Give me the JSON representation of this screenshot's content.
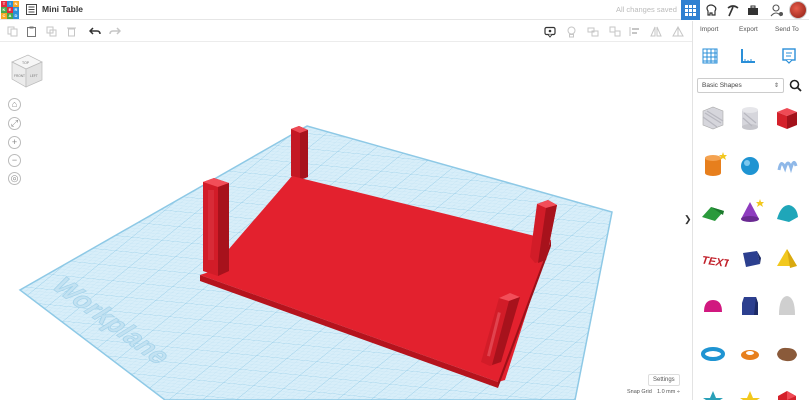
{
  "app": {
    "logo_letters": [
      "T",
      "I",
      "N",
      "K",
      "E",
      "R",
      "C",
      "A",
      "D"
    ],
    "logo_colors": [
      "#e4293c",
      "#2a8fd8",
      "#f5a623",
      "#4aa84a",
      "#e4293c",
      "#2a8fd8",
      "#f5a623",
      "#4aa84a",
      "#2a8fd8"
    ],
    "title": "Mini Table",
    "save_status": "All changes saved"
  },
  "panel": {
    "tabs": [
      "Import",
      "Export",
      "Send To"
    ],
    "shape_category": "Basic Shapes",
    "collapse_glyph": "❯",
    "shapes": [
      {
        "name": "box-hole",
        "color": "#c9c9cf"
      },
      {
        "name": "cylinder-hole",
        "color": "#c9c9cf"
      },
      {
        "name": "box",
        "color": "#d4212b"
      },
      {
        "name": "cylinder",
        "color": "#e77f1d"
      },
      {
        "name": "sphere",
        "color": "#1f94d2"
      },
      {
        "name": "scribble",
        "color": "#8fb8e8"
      },
      {
        "name": "roof",
        "color": "#2a9a3c"
      },
      {
        "name": "cone",
        "color": "#8e3cbf"
      },
      {
        "name": "round-roof",
        "color": "#1fa6b9"
      },
      {
        "name": "text",
        "color": "#c1202a"
      },
      {
        "name": "diamond",
        "color": "#2c3f8f"
      },
      {
        "name": "pyramid",
        "color": "#f2c81e"
      },
      {
        "name": "half-sphere",
        "color": "#d1187f"
      },
      {
        "name": "polygon",
        "color": "#2c3f8f"
      },
      {
        "name": "paraboloid",
        "color": "#cfcfcf"
      },
      {
        "name": "torus",
        "color": "#1f94d2"
      },
      {
        "name": "tube",
        "color": "#e77f1d"
      },
      {
        "name": "shape-generator",
        "color": "#8a5a3a"
      },
      {
        "name": "star",
        "color": "#2aa0b8"
      },
      {
        "name": "star-gold",
        "color": "#f2c81e"
      },
      {
        "name": "icosahedron",
        "color": "#d4212b"
      }
    ]
  },
  "canvas": {
    "workplane_label": "Workplane",
    "settings_label": "Settings",
    "snap_grid_label": "Snap Grid",
    "snap_grid_value": "1.0 mm ÷",
    "viewcube_faces": [
      "TOP",
      "FRONT",
      "LEFT"
    ],
    "model_color": "#e3212e",
    "grid_color": "#8ec9e6"
  }
}
